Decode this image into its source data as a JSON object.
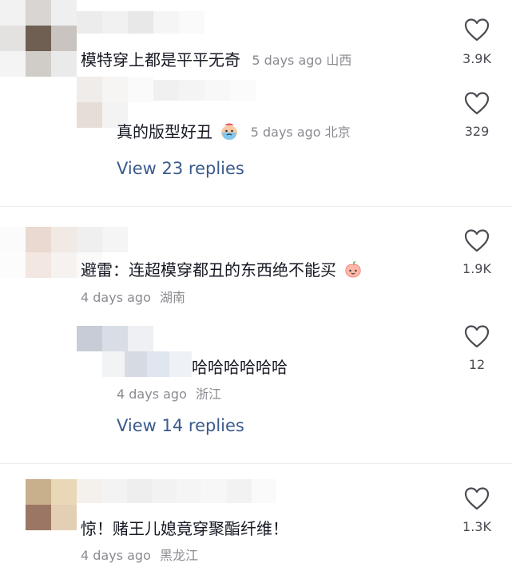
{
  "comments": [
    {
      "text": "模特穿上都是平平无奇",
      "time": "5 days ago",
      "location": "山西",
      "likes": "3.9K",
      "icon": "heart-icon"
    },
    {
      "text": "真的版型好丑",
      "time": "5 days ago",
      "location": "北京",
      "likes": "329",
      "emoji": "crying-face-emoji",
      "icon": "heart-icon"
    },
    {
      "text": "避雷：连超模穿都丑的东西绝不能买",
      "time": "4 days ago",
      "location": "湖南",
      "likes": "1.9K",
      "emoji": "peach-face-emoji",
      "icon": "heart-icon"
    },
    {
      "text": "哈哈哈哈哈哈",
      "time": "4 days ago",
      "location": "浙江",
      "likes": "12",
      "icon": "heart-icon"
    },
    {
      "text": "惊！赌王儿媳竟穿聚酯纤维！",
      "time": "4 days ago",
      "location": "黑龙江",
      "likes": "1.3K",
      "icon": "heart-icon"
    }
  ],
  "view_replies": [
    {
      "label": "View 23 replies"
    },
    {
      "label": "View 14 replies"
    }
  ],
  "colors": {
    "text": "#161823",
    "meta": "#8a8b91",
    "link": "#3a5a8c",
    "divider": "#ececee"
  }
}
